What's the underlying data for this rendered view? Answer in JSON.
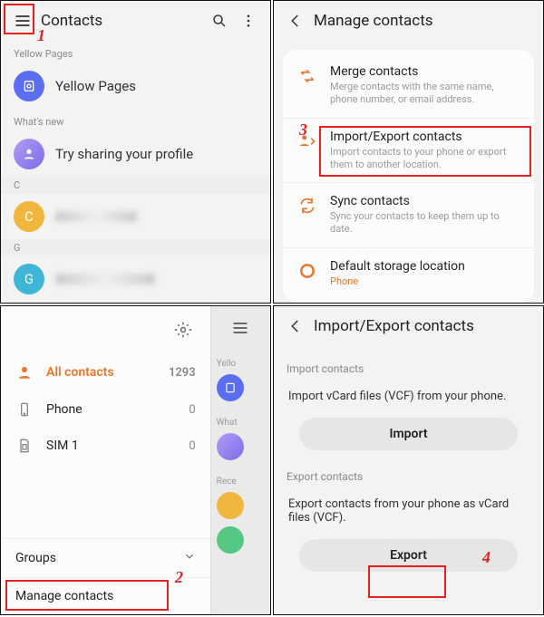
{
  "annotations": {
    "n1": "1",
    "n2": "2",
    "n3": "3",
    "n4": "4"
  },
  "p1": {
    "title": "Contacts",
    "sec_yellow": "Yellow Pages",
    "yellow_pages": "Yellow Pages",
    "sec_whatsnew": "What's new",
    "try_sharing": "Try sharing your profile",
    "sec_c": "C",
    "c_initial": "C",
    "sec_g": "G",
    "g_initial": "G"
  },
  "p2": {
    "title": "Manage contacts",
    "merge_t": "Merge contacts",
    "merge_d": "Merge contacts with the same name, phone number, or email address.",
    "ie_t": "Import/Export contacts",
    "ie_d": "Import contacts to your phone or export them to another location.",
    "sync_t": "Sync contacts",
    "sync_d": "Sync your contacts to keep them up to date.",
    "stor_t": "Default storage location",
    "stor_v": "Phone"
  },
  "p3": {
    "all": "All contacts",
    "all_n": "1293",
    "phone": "Phone",
    "phone_n": "0",
    "sim": "SIM 1",
    "sim_n": "0",
    "groups": "Groups",
    "manage": "Manage contacts",
    "bg_yello": "Yello",
    "bg_what": "What",
    "bg_rece": "Rece"
  },
  "p4": {
    "title": "Import/Export contacts",
    "imp_h": "Import contacts",
    "imp_d": "Import vCard files (VCF) from your phone.",
    "imp_b": "Import",
    "exp_h": "Export contacts",
    "exp_d": "Export contacts from your phone as vCard files (VCF).",
    "exp_b": "Export"
  }
}
